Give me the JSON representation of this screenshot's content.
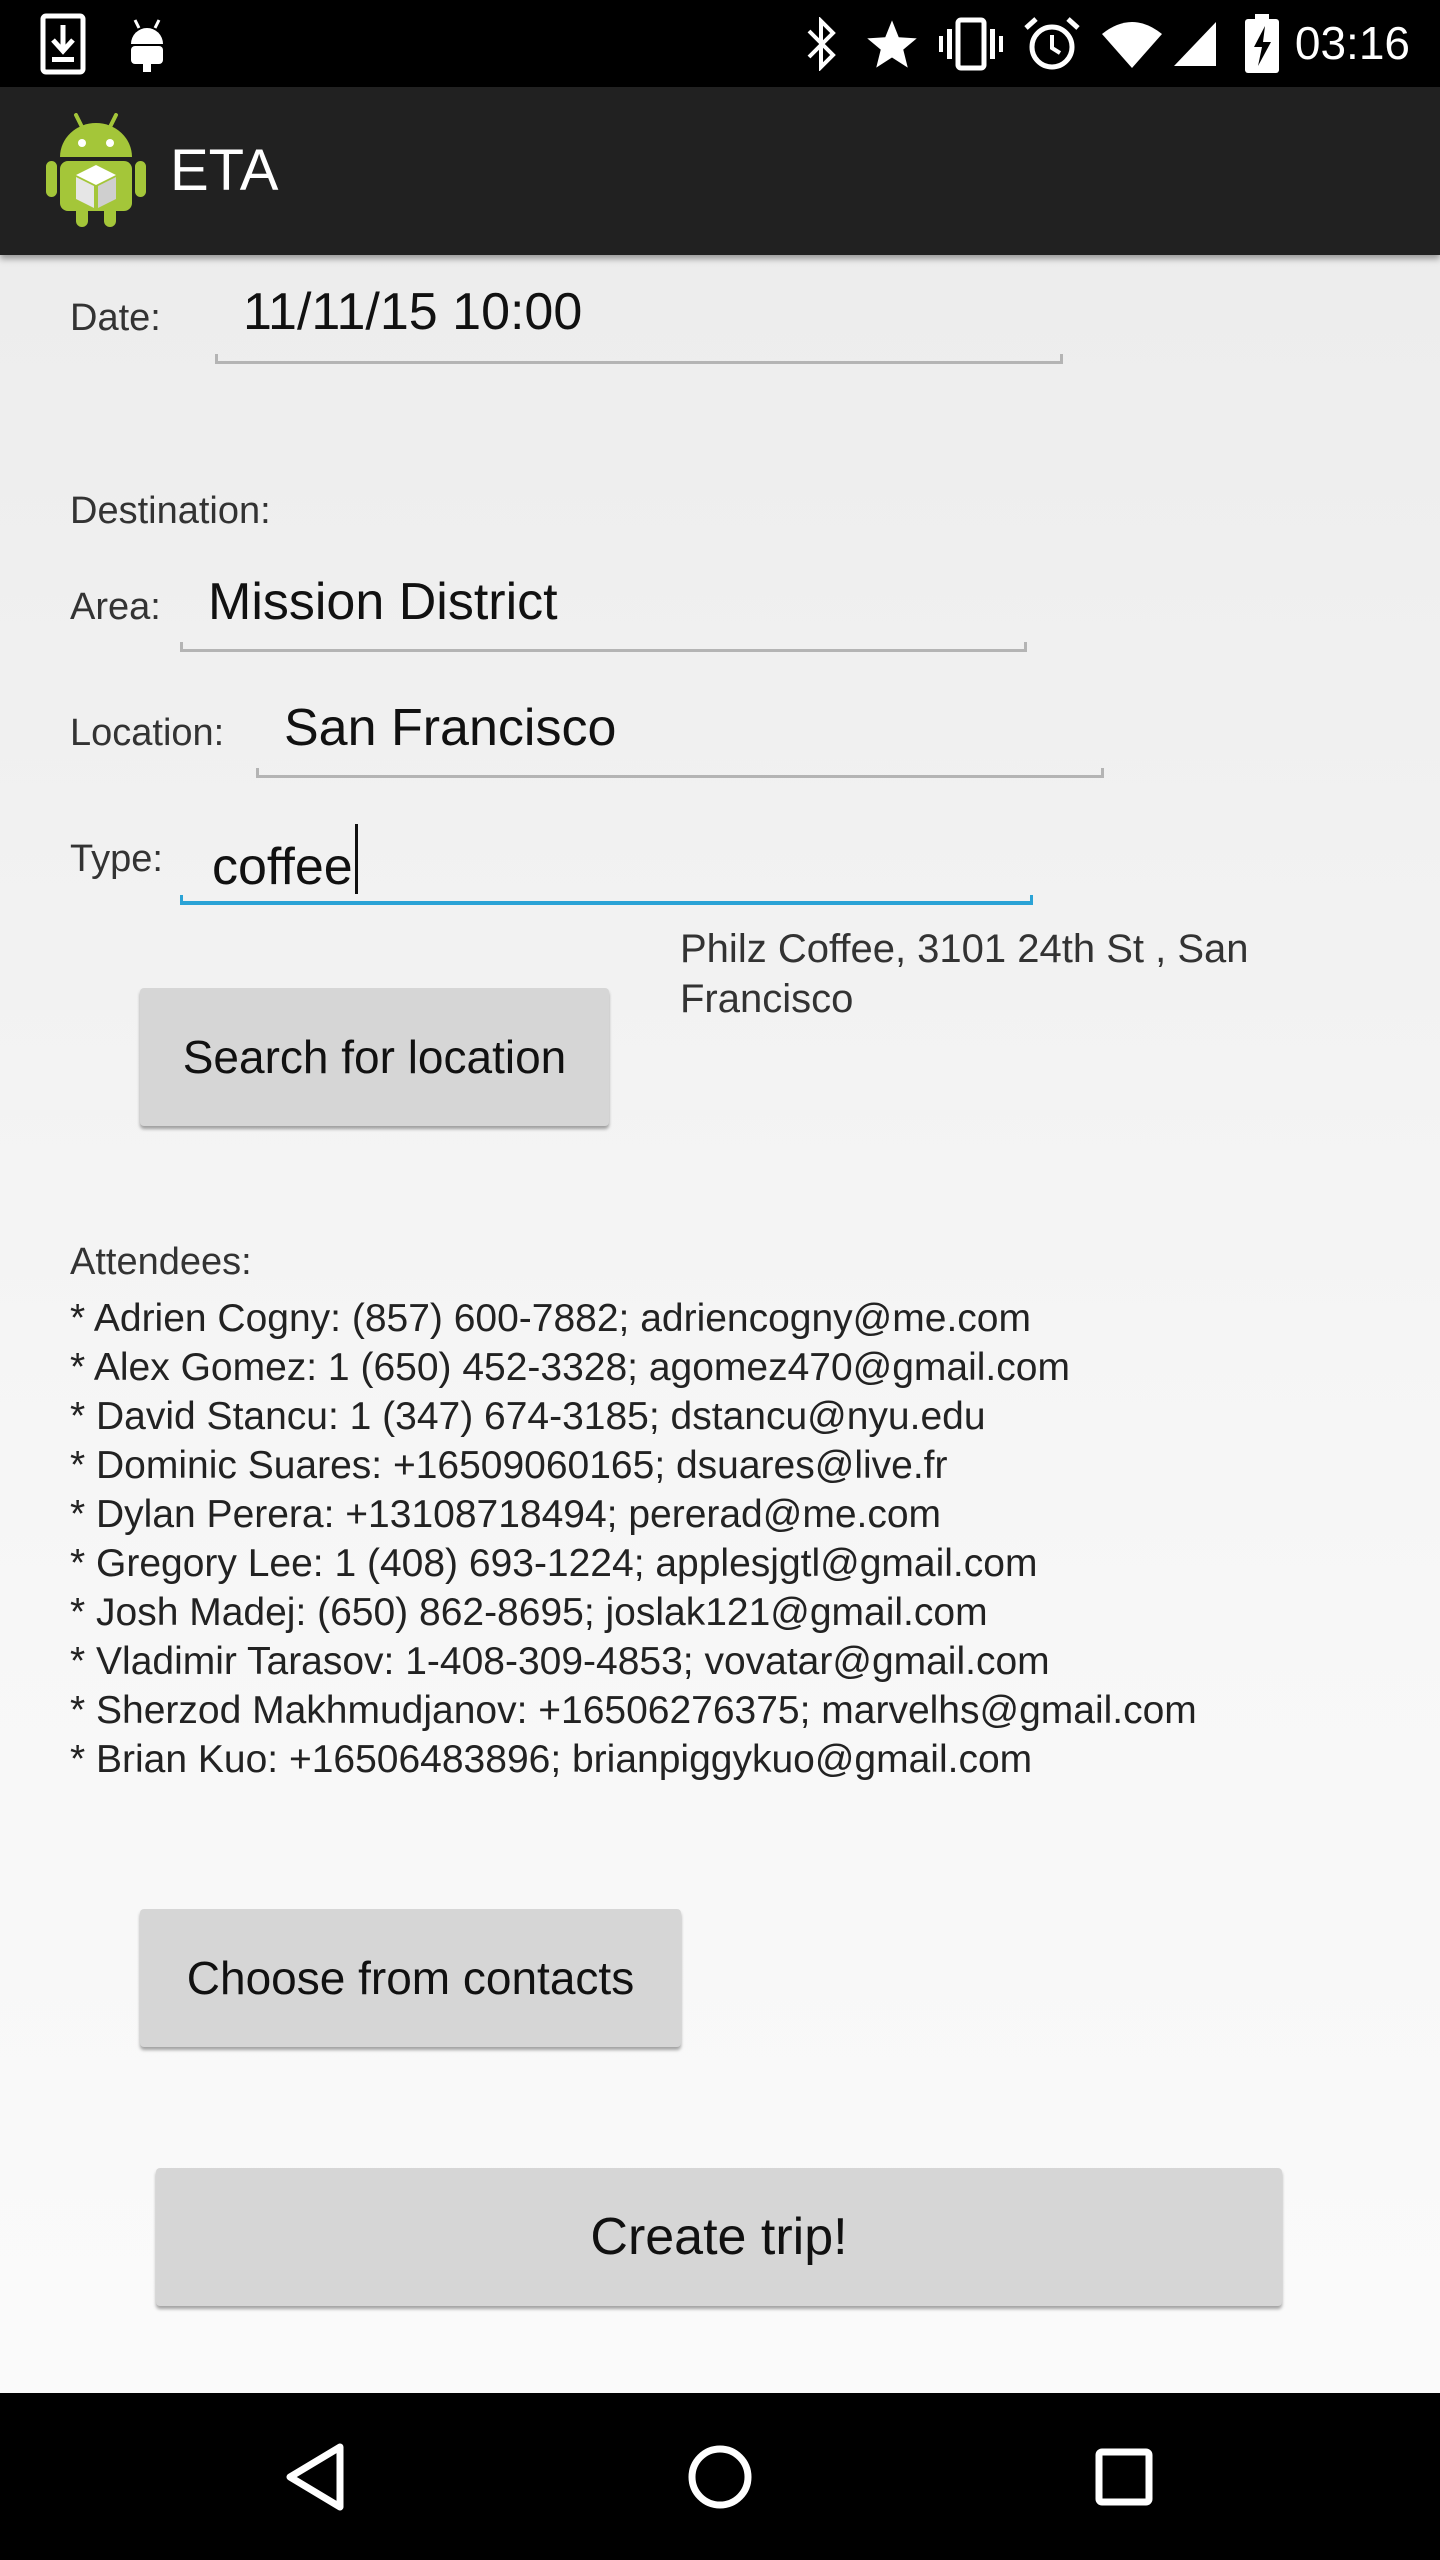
{
  "status_bar": {
    "time": "03:16",
    "left_icons": [
      "download-icon",
      "android-debug-icon"
    ],
    "right_icons": [
      "bluetooth-icon",
      "star-icon",
      "vibrate-icon",
      "alarm-icon",
      "wifi-icon",
      "signal-icon",
      "battery-charging-icon"
    ]
  },
  "app_bar": {
    "title": "ETA",
    "icon": "android-app-icon"
  },
  "form": {
    "date_label": "Date:",
    "date_value": "11/11/15 10:00",
    "destination_label": "Destination:",
    "area_label": "Area:",
    "area_value": "Mission District",
    "location_label": "Location:",
    "location_value": "San Francisco",
    "type_label": "Type:",
    "type_value": "coffee",
    "search_button": "Search for location",
    "result_line1": "Philz Coffee, 3101 24th St , San",
    "result_line2": "Francisco"
  },
  "attendees": {
    "label": "Attendees:",
    "items": [
      "* Adrien Cogny: (857) 600-7882; adriencogny@me.com",
      "* Alex Gomez: 1 (650) 452-3328; agomez470@gmail.com",
      "* David Stancu: 1 (347) 674-3185; dstancu@nyu.edu",
      "* Dominic Suares: +16509060165; dsuares@live.fr",
      "* Dylan Perera: +13108718494; pererad@me.com",
      "* Gregory Lee: 1 (408) 693-1224; applesjgtl@gmail.com",
      "* Josh Madej: (650) 862-8695; joslak121@gmail.com",
      "* Vladimir Tarasov: 1-408-309-4853; vovatar@gmail.com",
      "* Sherzod Makhmudjanov: +16506276375; marvelhs@gmail.com",
      "* Brian Kuo: +16506483896; brianpiggykuo@gmail.com"
    ],
    "choose_button": "Choose from contacts"
  },
  "create_button": "Create trip!",
  "nav_bar": {
    "icons": [
      "back-icon",
      "home-icon",
      "recents-icon"
    ]
  },
  "colors": {
    "status_bar": "#000000",
    "action_bar": "#212121",
    "focus_accent": "#2ba3d6",
    "button": "#d6d6d6",
    "android_green": "#a4c639"
  }
}
